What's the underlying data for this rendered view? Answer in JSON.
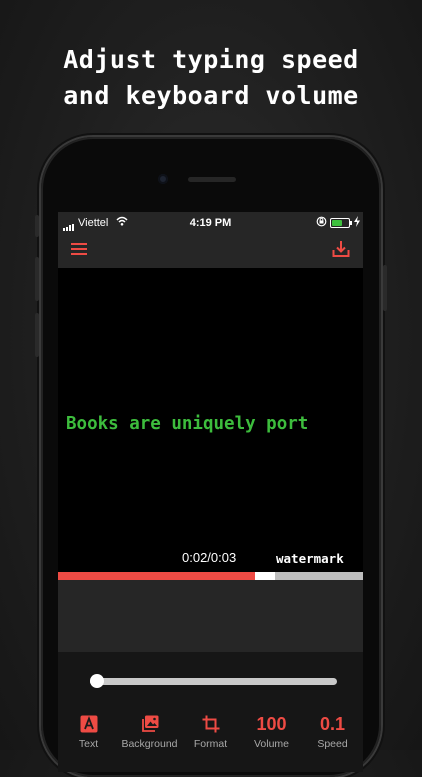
{
  "promo": {
    "headline_line1": "Adjust typing speed",
    "headline_line2": "and keyboard volume"
  },
  "status_bar": {
    "carrier": "Viettel",
    "time": "4:19 PM",
    "battery_level": 0.65,
    "battery_color": "#3ec13e"
  },
  "toolbar": {
    "menu_icon": "hamburger-menu-icon",
    "download_icon": "download-icon"
  },
  "preview": {
    "typed_text": "Books are uniquely port",
    "text_color": "#3dbd3d",
    "timecode": "0:02/0:03",
    "watermark": "watermark"
  },
  "playback": {
    "played_fraction": 0.645,
    "buffered_fraction": 0.71,
    "accent_color": "#ee4b44"
  },
  "slider": {
    "value_fraction": 0.03
  },
  "tabs": [
    {
      "icon": "text-icon",
      "label": "Text"
    },
    {
      "icon": "image-icon",
      "label": "Background"
    },
    {
      "icon": "crop-icon",
      "label": "Format"
    },
    {
      "value": "100",
      "label": "Volume"
    },
    {
      "value": "0.1",
      "label": "Speed"
    }
  ]
}
